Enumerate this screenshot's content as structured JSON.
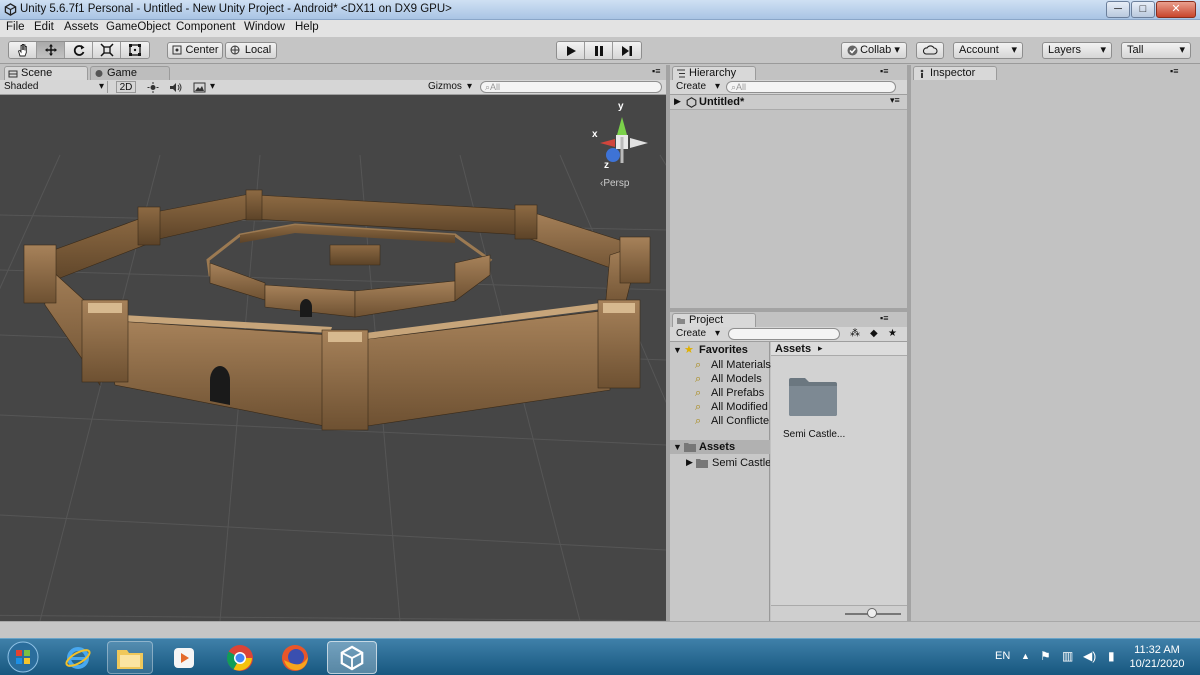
{
  "window": {
    "title": "Unity 5.6.7f1 Personal - Untitled - New Unity Project - Android* <DX11 on DX9 GPU>"
  },
  "window_controls": {
    "minimize": "─",
    "maximize": "□",
    "close": "✕"
  },
  "menu": [
    "File",
    "Edit",
    "Assets",
    "GameObject",
    "Component",
    "Window",
    "Help"
  ],
  "toolbar": {
    "tools": [
      "hand-tool",
      "move-tool",
      "rotate-tool",
      "scale-tool",
      "rect-tool"
    ],
    "pivot": "Center",
    "space": "Local",
    "collab": "Collab ▾",
    "account": "Account",
    "layers": "Layers",
    "layout": "Tall",
    "dropdown_arrow": "▾"
  },
  "scene_panel": {
    "tabs": [
      "Scene",
      "Game"
    ],
    "shading": "Shaded",
    "mode_2d": "2D",
    "gizmos": "Gizmos",
    "search_placeholder": "⌕All",
    "gizmo_labels": {
      "y": "y",
      "x": "x",
      "z": "z",
      "persp": "‹Persp"
    }
  },
  "hierarchy": {
    "tab": "Hierarchy",
    "create": "Create",
    "search_placeholder": "⌕All",
    "scene_name": "Untitled*"
  },
  "project": {
    "tab": "Project",
    "create": "Create",
    "favorites_label": "Favorites",
    "favorites": [
      "All Materials",
      "All Models",
      "All Prefabs",
      "All Modified",
      "All Conflicte"
    ],
    "assets_label": "Assets",
    "asset_folders": [
      "Semi Castle"
    ],
    "breadcrumb": "Assets",
    "breadcrumb_arrow": "▸",
    "grid_items": [
      "Semi Castle..."
    ]
  },
  "inspector": {
    "tab": "Inspector"
  },
  "taskbar": {
    "apps": [
      "start-orb",
      "internet-explorer",
      "file-explorer",
      "media-player",
      "chrome",
      "firefox",
      "unity"
    ],
    "language": "EN",
    "time": "11:32 AM",
    "date": "10/21/2020"
  },
  "colors": {
    "scene_bg": "#464646",
    "wall": "#8a6a45",
    "taskbar": "#1f6a95",
    "panel": "#c2c2c2"
  }
}
